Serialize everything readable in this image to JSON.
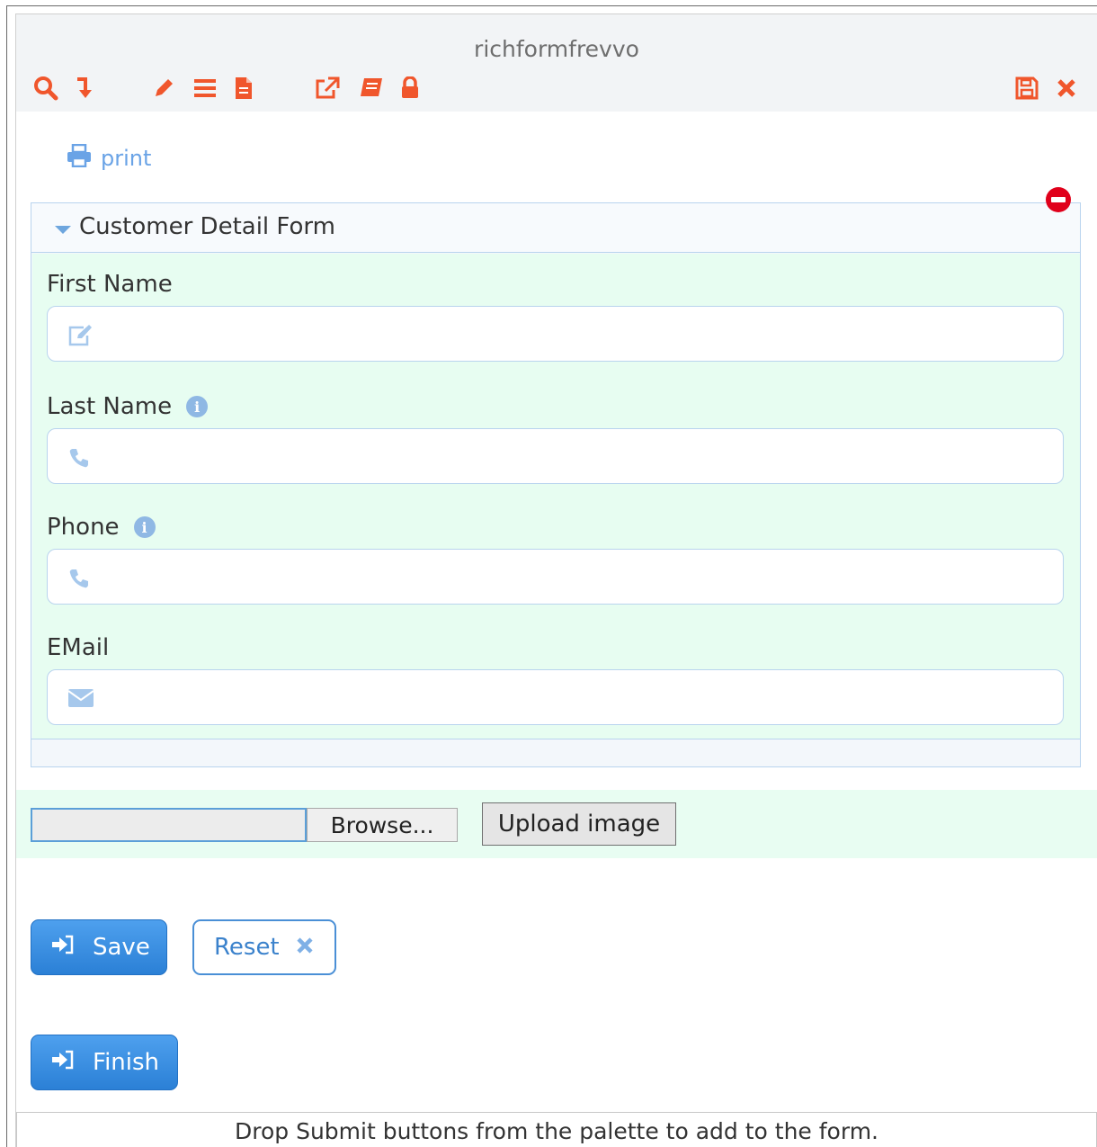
{
  "window": {
    "title": "richformfrevvo"
  },
  "toolbar": {
    "icons": [
      "search-icon",
      "move-down-icon",
      "edit-icon",
      "list-icon",
      "document-icon",
      "external-link-icon",
      "book-icon",
      "lock-icon",
      "save-icon",
      "close-icon"
    ],
    "accent_color": "#f0562c"
  },
  "print": {
    "label": "print"
  },
  "section": {
    "title": "Customer Detail Form",
    "fields": [
      {
        "label": "First Name",
        "icon": "edit-icon",
        "value": "",
        "has_info": false
      },
      {
        "label": "Last Name",
        "icon": "phone-icon",
        "value": "",
        "has_info": true
      },
      {
        "label": "Phone",
        "icon": "phone-icon",
        "value": "",
        "has_info": true
      },
      {
        "label": "EMail",
        "icon": "envelope-icon",
        "value": "",
        "has_info": false
      }
    ]
  },
  "upload": {
    "browse_label": "Browse...",
    "upload_label": "Upload image"
  },
  "buttons": {
    "save_label": "Save",
    "reset_label": "Reset",
    "finish_label": "Finish"
  },
  "drop_hint": "Drop Submit buttons from the palette to add to the form.",
  "colors": {
    "primary": "#2f86dc",
    "section_bg": "#e7fdf1",
    "link": "#6aa3e6"
  }
}
